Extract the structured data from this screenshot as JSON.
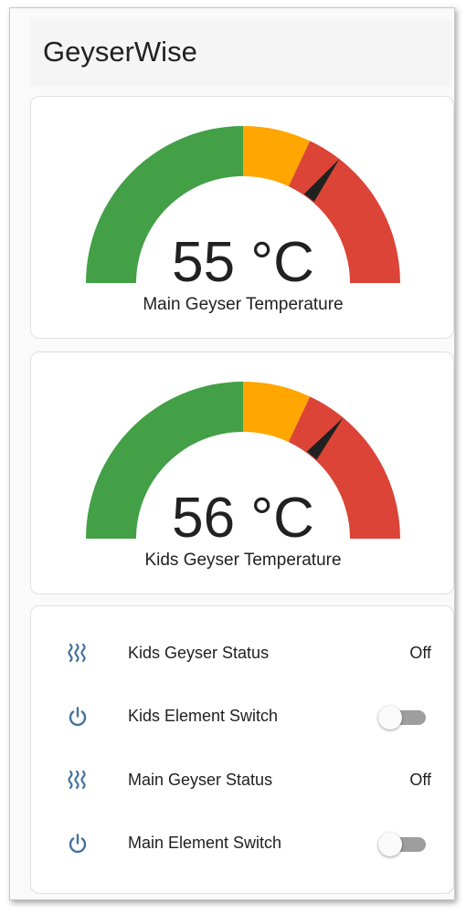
{
  "app": {
    "title": "GeyserWise"
  },
  "gauges": [
    {
      "value_text": "55 °C",
      "label": "Main Geyser Temperature",
      "value_fraction": 0.71,
      "segments": [
        {
          "color": "#43a047",
          "from": 0.0,
          "to": 0.5
        },
        {
          "color": "#ffa600",
          "from": 0.5,
          "to": 0.64
        },
        {
          "color": "#db4437",
          "from": 0.64,
          "to": 1.0
        }
      ]
    },
    {
      "value_text": "56 °C",
      "label": "Kids Geyser Temperature",
      "value_fraction": 0.72,
      "segments": [
        {
          "color": "#43a047",
          "from": 0.0,
          "to": 0.5
        },
        {
          "color": "#ffa600",
          "from": 0.5,
          "to": 0.64
        },
        {
          "color": "#db4437",
          "from": 0.64,
          "to": 1.0
        }
      ]
    }
  ],
  "entities": [
    {
      "icon": "heat-waves-icon",
      "label": "Kids Geyser Status",
      "state": "Off",
      "type": "sensor"
    },
    {
      "icon": "power-icon",
      "label": "Kids Element Switch",
      "state": false,
      "type": "switch"
    },
    {
      "icon": "heat-waves-icon",
      "label": "Main Geyser Status",
      "state": "Off",
      "type": "sensor"
    },
    {
      "icon": "power-icon",
      "label": "Main Element Switch",
      "state": false,
      "type": "switch"
    }
  ],
  "colors": {
    "icon": "#44739e",
    "text": "#212121",
    "needle": "#212121"
  }
}
